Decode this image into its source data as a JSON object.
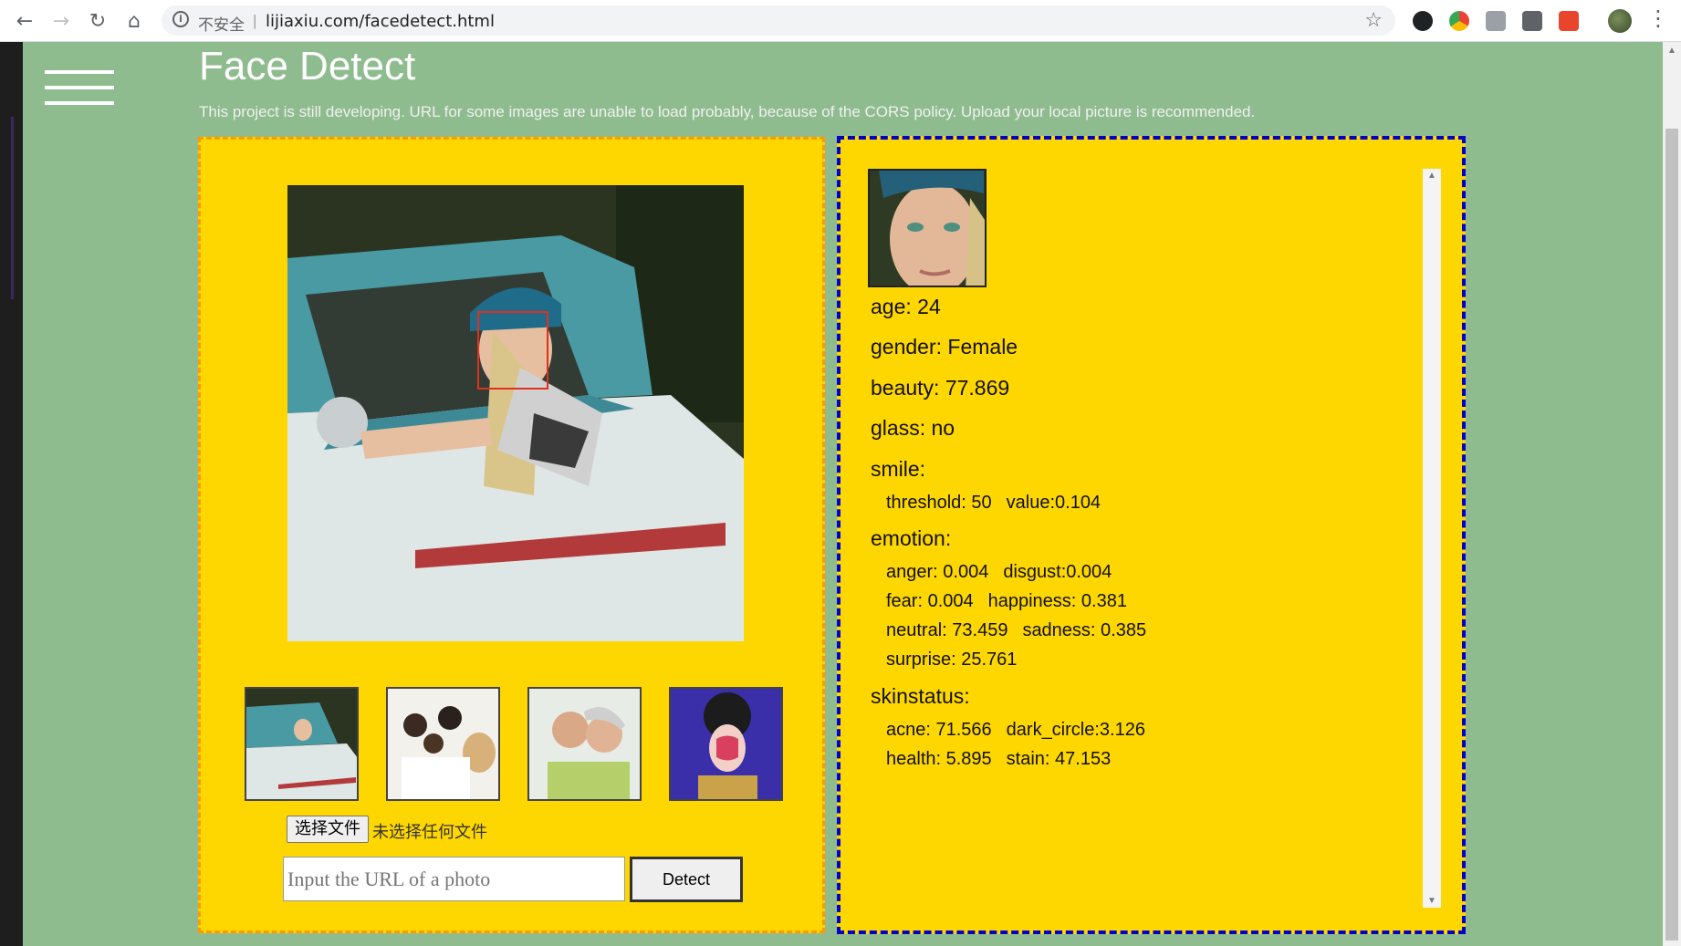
{
  "browser": {
    "insecure_label": "不安全",
    "separator": "|",
    "url": "lijiaxiu.com/facedetect.html"
  },
  "page": {
    "title": "Face Detect",
    "notice": "This project is still developing. URL for some images are unable to load probably, because of the CORS policy. Upload your local picture is recommended."
  },
  "upload": {
    "choose_file_label": "选择文件",
    "file_status": "未选择任何文件",
    "url_placeholder": "Input the URL of a photo",
    "url_value": "",
    "detect_label": "Detect"
  },
  "result": {
    "age": "age: 24",
    "gender": "gender: Female",
    "beauty": "beauty: 77.869",
    "glass": "glass: no",
    "smile_heading": "smile:",
    "smile_threshold": "threshold: 50",
    "smile_value": "value:0.104",
    "emotion_heading": "emotion:",
    "anger": "anger: 0.004",
    "disgust": "disgust:0.004",
    "fear": "fear: 0.004",
    "happiness": "happiness: 0.381",
    "neutral": "neutral: 73.459",
    "sadness": "sadness: 0.385",
    "surprise": "surprise: 25.761",
    "skin_heading": "skinstatus:",
    "acne": "acne: 71.566",
    "dark_circle": "dark_circle:3.126",
    "health": "health: 5.895",
    "stain": "stain: 47.153"
  },
  "colors": {
    "page_bg": "#8fbc8f",
    "panel_bg": "#ffd700",
    "left_border": "#ff9900",
    "right_border": "#0000cc",
    "face_box": "#e0301e"
  }
}
